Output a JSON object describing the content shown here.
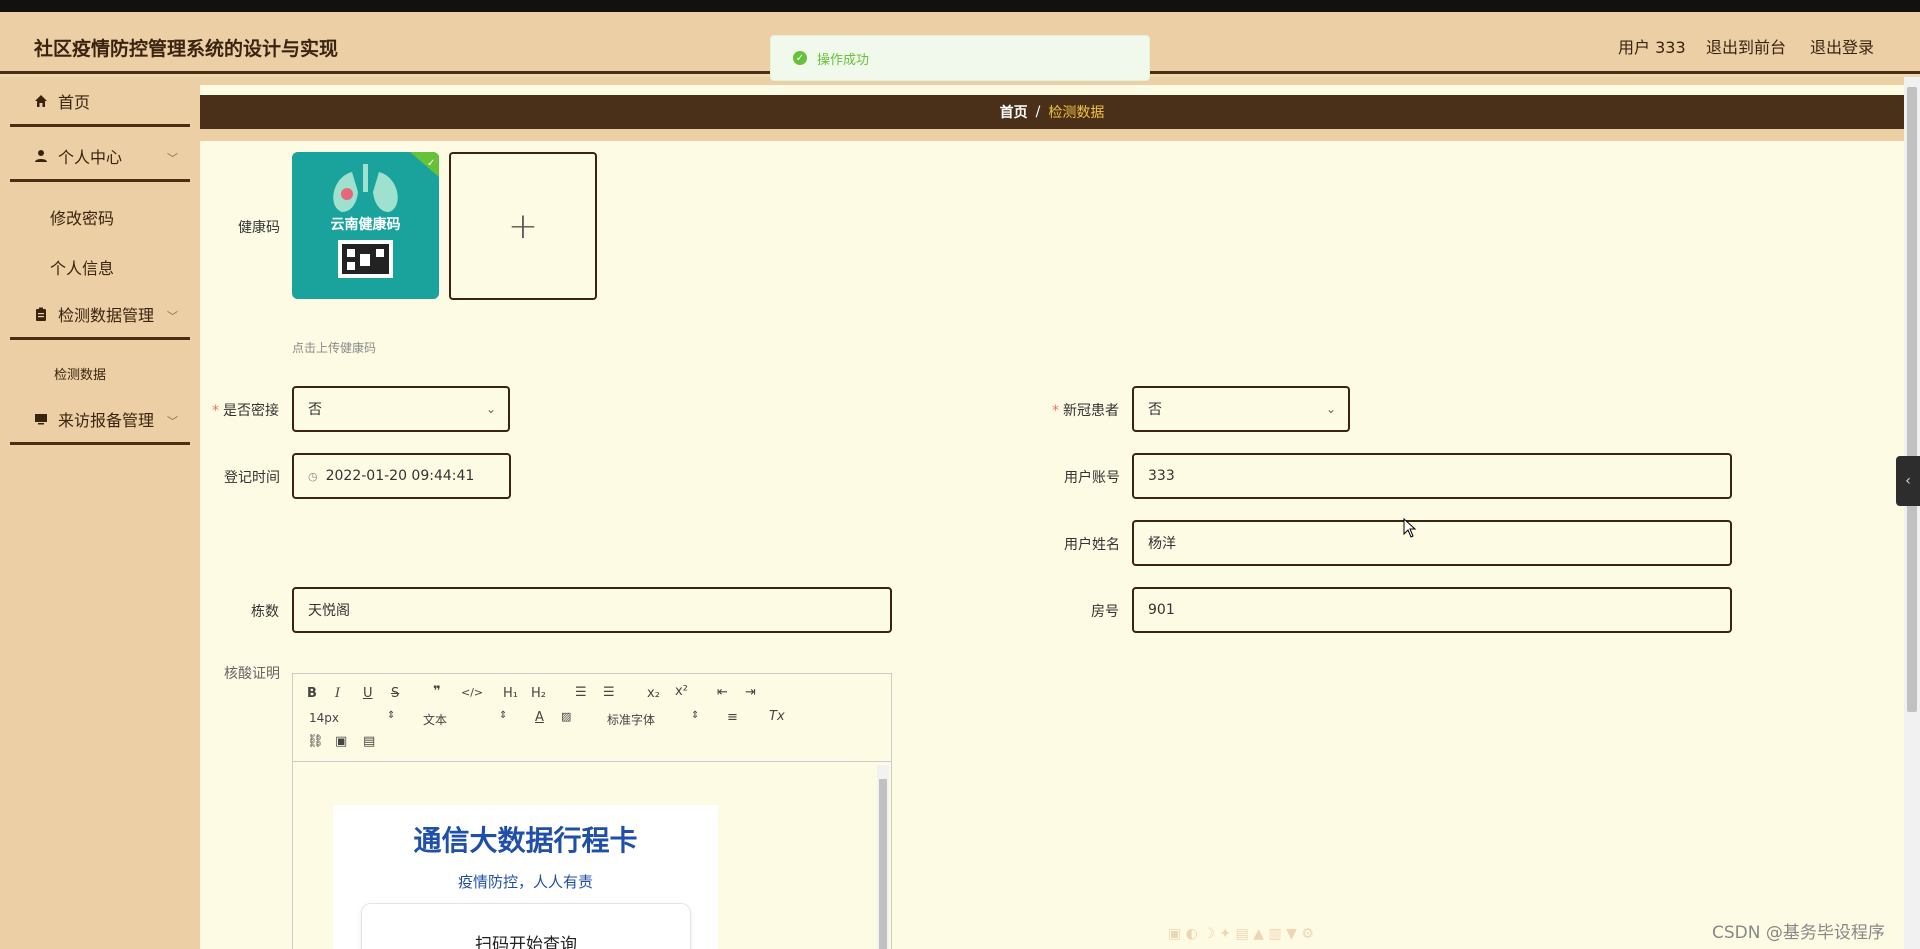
{
  "header": {
    "app_title": "社区疫情防控管理系统的设计与实现",
    "user": "用户 333",
    "to_frontend": "退出到前台",
    "logout": "退出登录"
  },
  "toast": {
    "message": "操作成功"
  },
  "sidebar": {
    "home": "首页",
    "personal_center": "个人中心",
    "change_password": "修改密码",
    "personal_info": "个人信息",
    "detection_mgmt": "检测数据管理",
    "detection_data": "检测数据",
    "visit_mgmt": "来访报备管理"
  },
  "breadcrumb": {
    "home": "首页",
    "separator": "/",
    "current": "检测数据"
  },
  "form": {
    "health_code_label": "健康码",
    "health_code_thumb_text": "云南健康码",
    "upload_plus": "+",
    "upload_hint": "点击上传健康码",
    "close_contact_label": "是否密接",
    "close_contact_value": "否",
    "covid_patient_label": "新冠患者",
    "covid_patient_value": "否",
    "register_time_label": "登记时间",
    "register_time_value": "2022-01-20 09:44:41",
    "account_label": "用户账号",
    "account_value": "333",
    "name_label": "用户姓名",
    "name_value": "杨洋",
    "building_label": "栋数",
    "building_value": "天悦阁",
    "room_label": "房号",
    "room_value": "901",
    "nucleic_label": "核酸证明"
  },
  "editor": {
    "font_size": "14px",
    "paragraph": "文本",
    "font_family": "标准字体",
    "card_title": "通信大数据行程卡",
    "card_subtitle": "疫情防控，人人有责",
    "card_button": "扫码开始查询"
  },
  "watermark": "CSDN @基务毕设程序",
  "colors": {
    "accent": "#4a3019",
    "sidebar_bg": "#eccfa5",
    "content_bg": "#fefbe4",
    "breadcrumb_active": "#f1c343"
  }
}
